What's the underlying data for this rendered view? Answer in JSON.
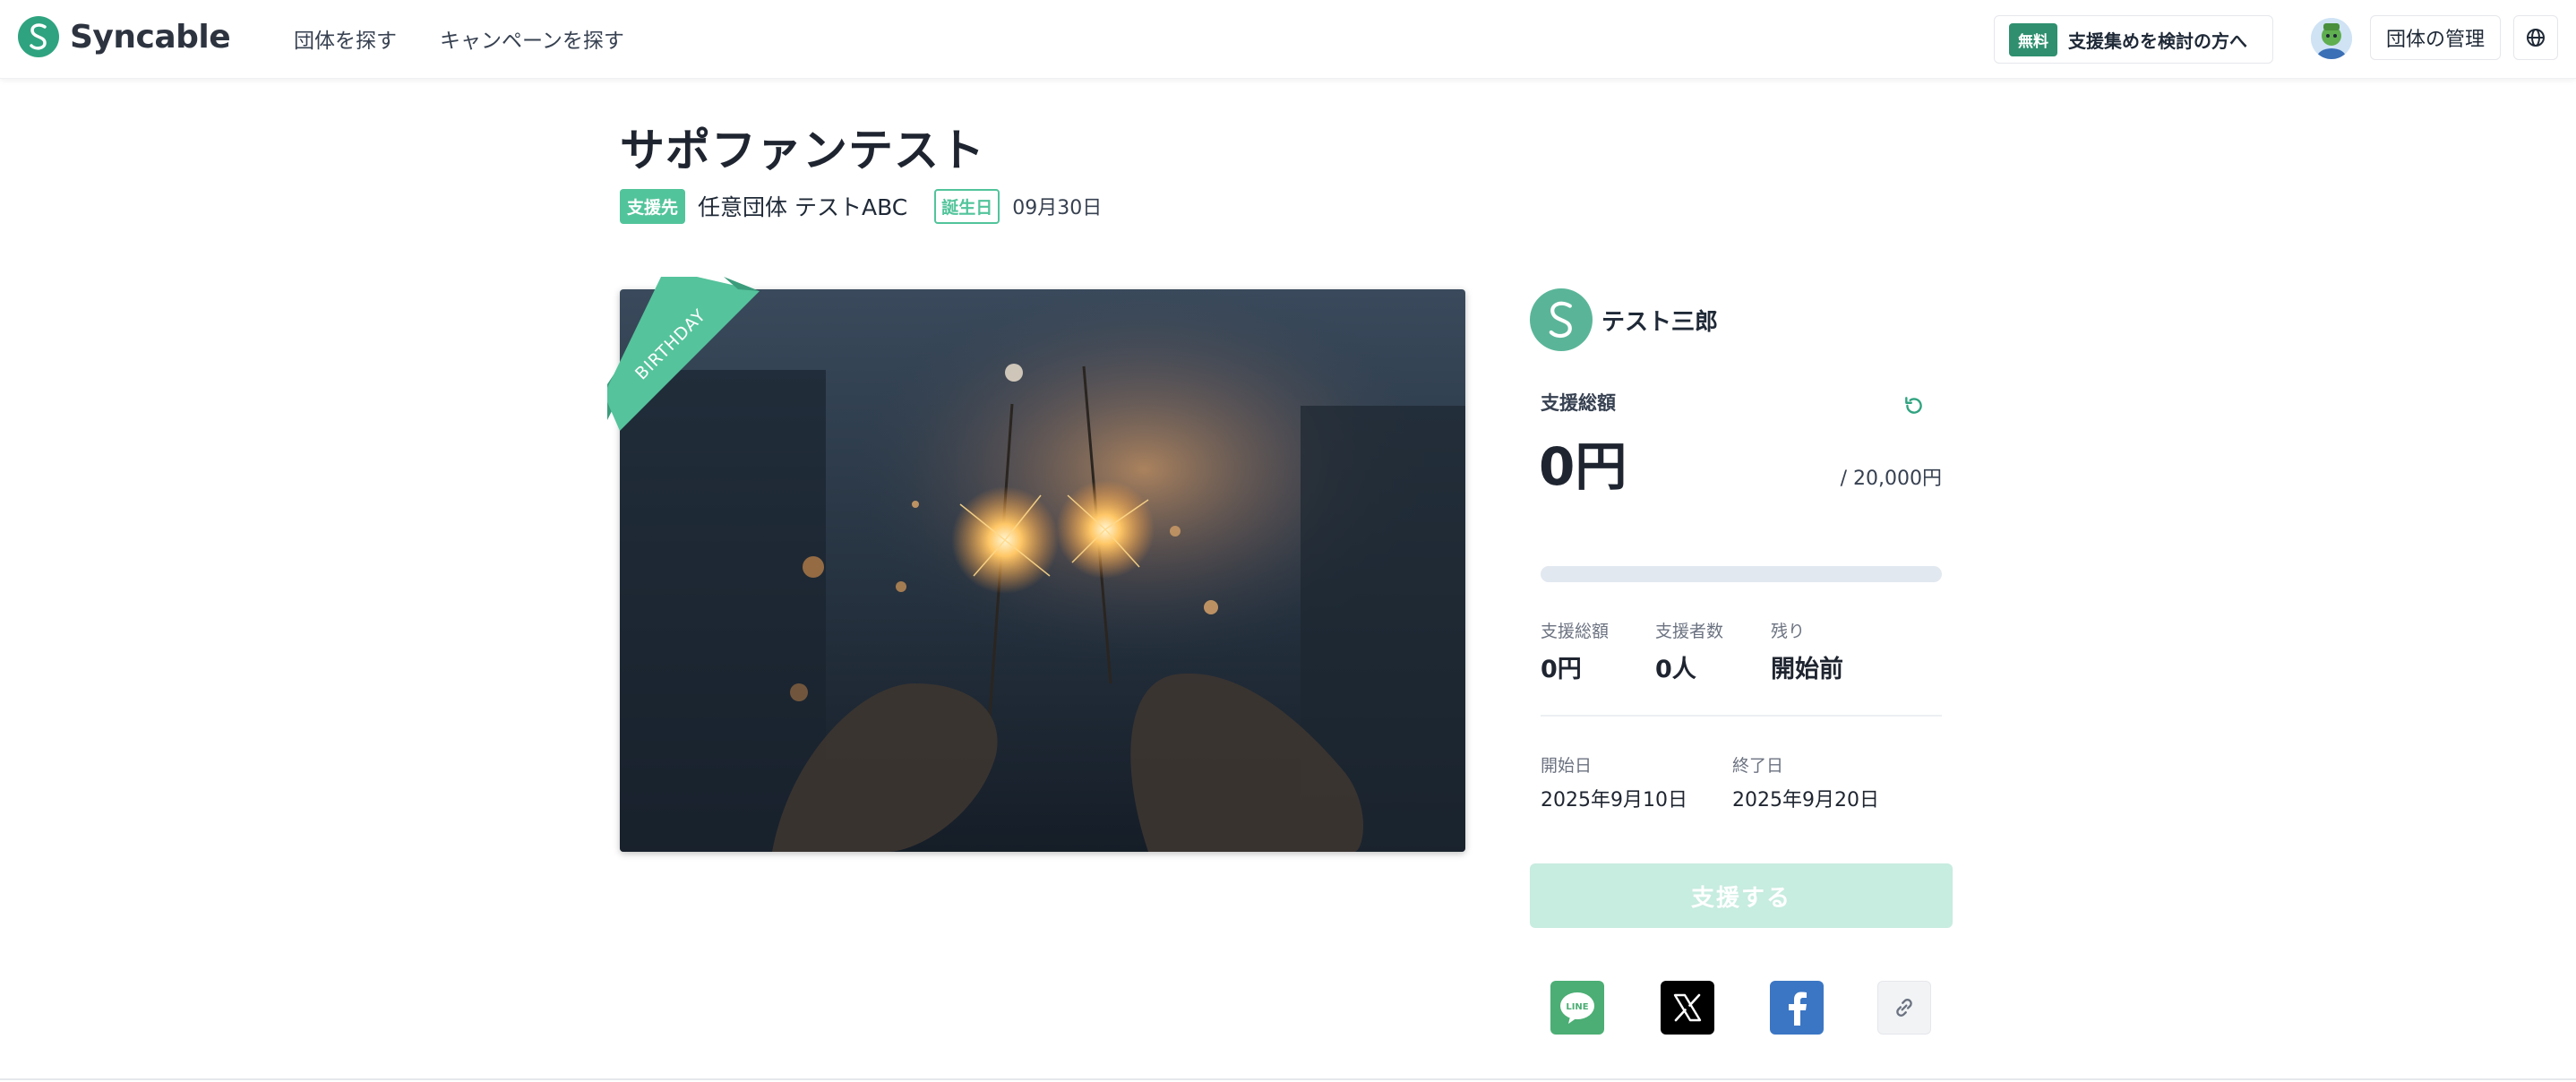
{
  "header": {
    "brand": "Syncable",
    "nav": [
      "団体を探す",
      "キャンペーンを探す"
    ],
    "cta_badge": "無料",
    "cta_label": "支援集めを検討の方へ",
    "manage_label": "団体の管理"
  },
  "campaign": {
    "title": "サポファンテスト",
    "recipient_tag": "支援先",
    "recipient_name": "任意団体 テストABC",
    "birthday_tag": "誕生日",
    "birthday": "09月30日",
    "ribbon_text": "BIRTHDAY"
  },
  "panel": {
    "owner_name": "テスト三郎",
    "total_label": "支援総額",
    "total_amount": "0円",
    "goal_text": "/ 20,000円",
    "progress_fraction": 0,
    "stats": [
      {
        "label": "支援総額",
        "value": "0円"
      },
      {
        "label": "支援者数",
        "value": "0人"
      },
      {
        "label": "残り",
        "value": "開始前"
      }
    ],
    "start_label": "開始日",
    "start_date": "2025年9月10日",
    "end_label": "終了日",
    "end_date": "2025年9月20日",
    "support_button": "支援する"
  },
  "share": {
    "line_text": "LINE"
  },
  "colors": {
    "accent": "#52c49b",
    "brand": "#2fa37f",
    "line": "#4cae74",
    "x": "#000000",
    "facebook": "#3b76c4"
  }
}
